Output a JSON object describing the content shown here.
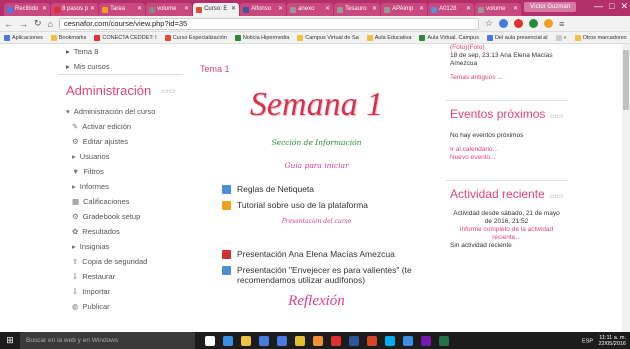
{
  "browser": {
    "tabs": [
      {
        "label": "Recibido",
        "color": "#4a7be0",
        "active": false
      },
      {
        "label": "8 pasos p",
        "color": "#e03030",
        "active": false
      },
      {
        "label": "Tarea",
        "color": "#f0a020",
        "active": false
      },
      {
        "label": "volume",
        "color": "#888888",
        "active": false
      },
      {
        "label": "Curso: E",
        "color": "#e05030",
        "active": true
      },
      {
        "label": "Alfonso",
        "color": "#3b5998",
        "active": false
      },
      {
        "label": "anexo",
        "color": "#999999",
        "active": false
      },
      {
        "label": "Tesauro",
        "color": "#999999",
        "active": false
      },
      {
        "label": "APAimp",
        "color": "#999999",
        "active": false
      },
      {
        "label": "A0128",
        "color": "#5a8ed8",
        "active": false
      },
      {
        "label": "volume",
        "color": "#999999",
        "active": false
      }
    ],
    "user_label": "Víctor Guzmán",
    "window_controls": [
      "—",
      "□",
      "✕"
    ],
    "url": "cesnafor.com/course/view.php?id=35",
    "bookmarks": [
      {
        "label": "Aplicaciones",
        "color": "#4a7be0"
      },
      {
        "label": "Bookmarks",
        "color": "#f0c040"
      },
      {
        "label": "CONECTA CEDDET: I",
        "color": "#e03030"
      },
      {
        "label": "Curso Especialización",
        "color": "#e05030"
      },
      {
        "label": "Noticia Hipermedia",
        "color": "#2a8a3a"
      },
      {
        "label": "Campus Virtual de Sa",
        "color": "#f0c040"
      },
      {
        "label": "Aula Educativa",
        "color": "#f0c040"
      },
      {
        "label": "Aula Virtual. Campus",
        "color": "#2a8a3a"
      },
      {
        "label": "Del aula presencial al",
        "color": "#4a7be0"
      },
      {
        "label": "»",
        "color": "#cccccc"
      },
      {
        "label": "Otros marcadores",
        "color": "#f0c040"
      }
    ]
  },
  "left": {
    "top_items": [
      {
        "label": "Tema 8",
        "icon": "▸"
      },
      {
        "label": "Mis cursos",
        "icon": "▸"
      }
    ],
    "admin_title": "Administración",
    "admin_items": [
      {
        "label": "Administración del curso",
        "icon": "▾"
      },
      {
        "label": "Activar edición",
        "icon": "✎"
      },
      {
        "label": "Editar ajustes",
        "icon": "⚙"
      },
      {
        "label": "Usuarios",
        "icon": "▸"
      },
      {
        "label": "Filtros",
        "icon": "▼"
      },
      {
        "label": "Informes",
        "icon": "▸"
      },
      {
        "label": "Calificaciones",
        "icon": "▦"
      },
      {
        "label": "Gradebook setup",
        "icon": "⚙"
      },
      {
        "label": "Resultados",
        "icon": "✿"
      },
      {
        "label": "Insignias",
        "icon": "▸"
      },
      {
        "label": "Copia de seguridad",
        "icon": "⇪"
      },
      {
        "label": "Restaurar",
        "icon": "⇩"
      },
      {
        "label": "Importar",
        "icon": "⇩"
      },
      {
        "label": "Publicar",
        "icon": "◍"
      }
    ]
  },
  "main": {
    "topic": "Tema 1",
    "heading": "Semana 1",
    "section_info": "Sección de Información",
    "guide": "Guía para iniciar",
    "resources_a": [
      {
        "label": "Reglas de Netiqueta",
        "color": "#4a90d0"
      },
      {
        "label": "Tutorial sobre uso de la plataforma",
        "color": "#f0a020"
      }
    ],
    "course_presentation": "Presentación del curso",
    "resources_b": [
      {
        "label": "Presentación Ana Elena Macías Amezcua",
        "color": "#d03030"
      },
      {
        "label": "Presentación \"Envejecer es para valientes\" (te recomendamos utilizar audífonos)",
        "color": "#4a90d0"
      }
    ],
    "bottom_text": "Reflexión"
  },
  "right": {
    "post_line1": "(Foto)(Foto)",
    "post_line2": "18 de sep, 23:13 Ana Elena Macías Amezcua",
    "older_topics": "Temas antiguos ...",
    "events_title": "Eventos próximos",
    "no_events": "No hay eventos próximos",
    "calendar_link": "Ir al calendario...",
    "new_event_link": "Nuevo evento...",
    "activity_title": "Actividad reciente",
    "activity_since": "Actividad desde sábado, 21 de mayo de 2016, 21:52",
    "full_report": "Informe completo de la actividad reciente...",
    "no_activity": "Sin actividad reciente"
  },
  "taskbar": {
    "search_placeholder": "Buscar en la web y en Windows",
    "icons": [
      {
        "name": "task-view-icon",
        "color": "#ffffff"
      },
      {
        "name": "edge-icon",
        "color": "#3a8ee6"
      },
      {
        "name": "file-explorer-icon",
        "color": "#f0c040"
      },
      {
        "name": "store-icon",
        "color": "#4a7be0"
      },
      {
        "name": "mail-icon",
        "color": "#4a7be0"
      },
      {
        "name": "chrome-icon",
        "color": "#e0c030"
      },
      {
        "name": "media-icon",
        "color": "#f09030"
      },
      {
        "name": "opera-icon",
        "color": "#e03030"
      },
      {
        "name": "word-icon",
        "color": "#2b579a"
      },
      {
        "name": "powerpoint-icon",
        "color": "#d24726"
      },
      {
        "name": "skype-icon",
        "color": "#00aff0"
      },
      {
        "name": "ie-icon",
        "color": "#3a8ee6"
      },
      {
        "name": "onenote-icon",
        "color": "#7719aa"
      },
      {
        "name": "excel-icon",
        "color": "#217346"
      }
    ],
    "lang": "ESP",
    "time": "11:11 a. m.",
    "date": "22/05/2016"
  }
}
